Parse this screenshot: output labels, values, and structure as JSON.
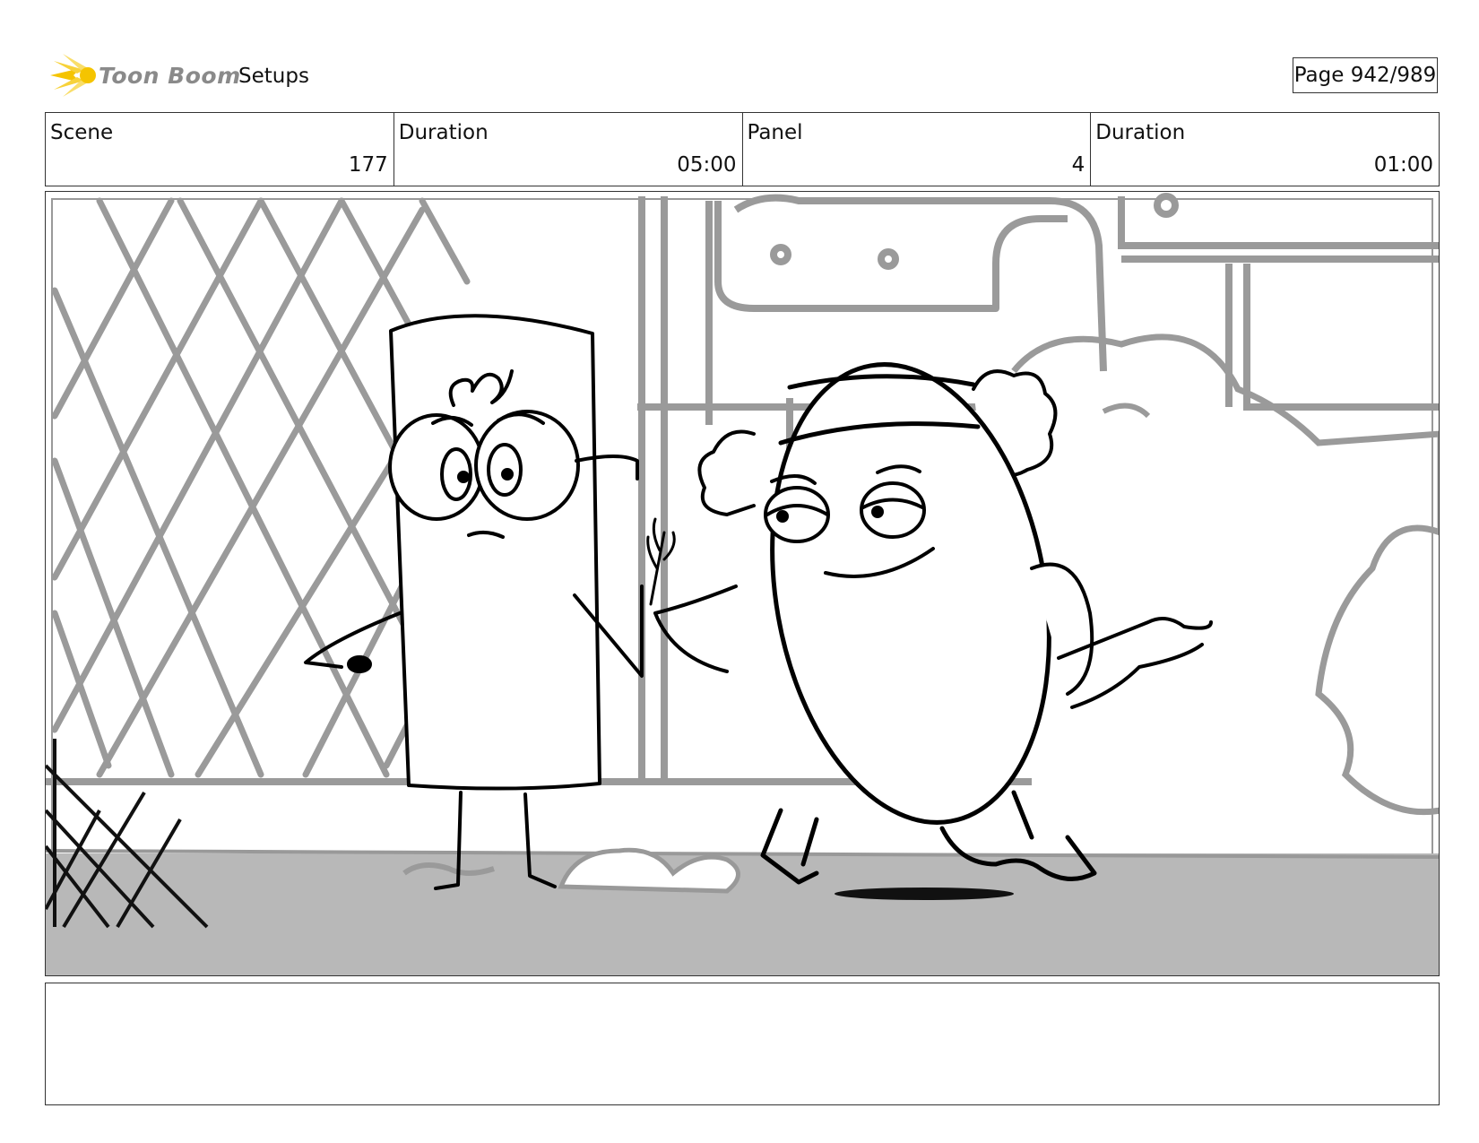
{
  "header": {
    "logo_name": "Toon Boom",
    "logo_icon": "sun-burst-icon",
    "section": "Setups",
    "page": "Page 942/989"
  },
  "info": {
    "scene_label": "Scene",
    "scene_value": "177",
    "scene_duration_label": "Duration",
    "scene_duration_value": "05:00",
    "panel_label": "Panel",
    "panel_value": "4",
    "panel_duration_label": "Duration",
    "panel_duration_value": "01:00"
  },
  "colors": {
    "logo_yellow": "#f5c400",
    "sketch_gray": "#9a9a9a",
    "floor_gray": "#b4b4b4",
    "ink": "#000000"
  },
  "notes": ""
}
